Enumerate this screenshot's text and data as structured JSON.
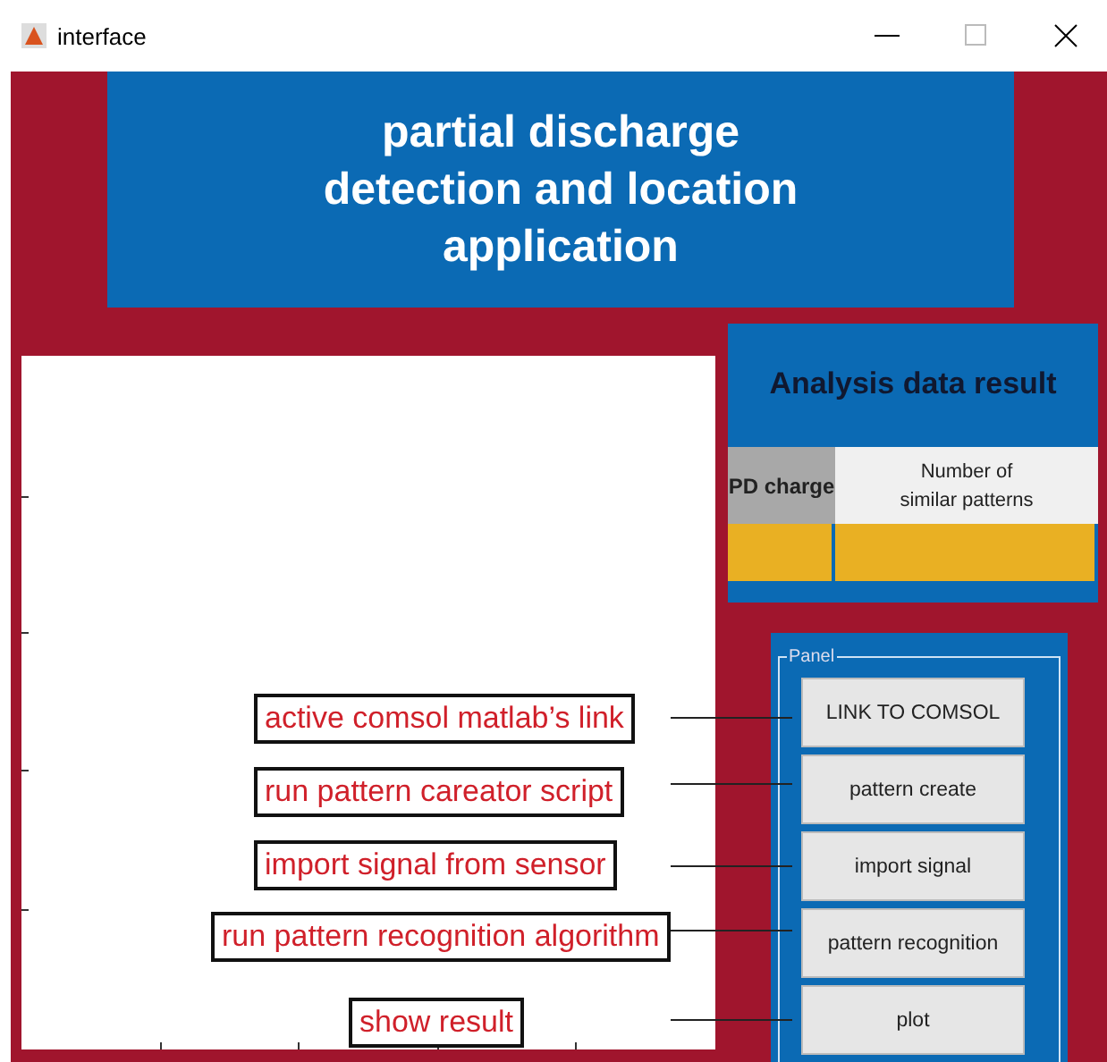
{
  "window": {
    "title": "interface"
  },
  "header": {
    "title": "partial discharge\ndetection and location\napplication"
  },
  "analysis": {
    "title": "Analysis data result",
    "columns": [
      "PD charge",
      "Number of\nsimilar patterns"
    ]
  },
  "panel": {
    "title": "Panel",
    "buttons": [
      "LINK TO COMSOL",
      "pattern create",
      "import signal",
      "pattern recognition",
      "plot"
    ]
  },
  "annotations": [
    {
      "text": "active comsol matlab’s link"
    },
    {
      "text": "run pattern careator script"
    },
    {
      "text": "import signal from sensor"
    },
    {
      "text": "run pattern recognition algorithm"
    },
    {
      "text": "show result"
    }
  ]
}
